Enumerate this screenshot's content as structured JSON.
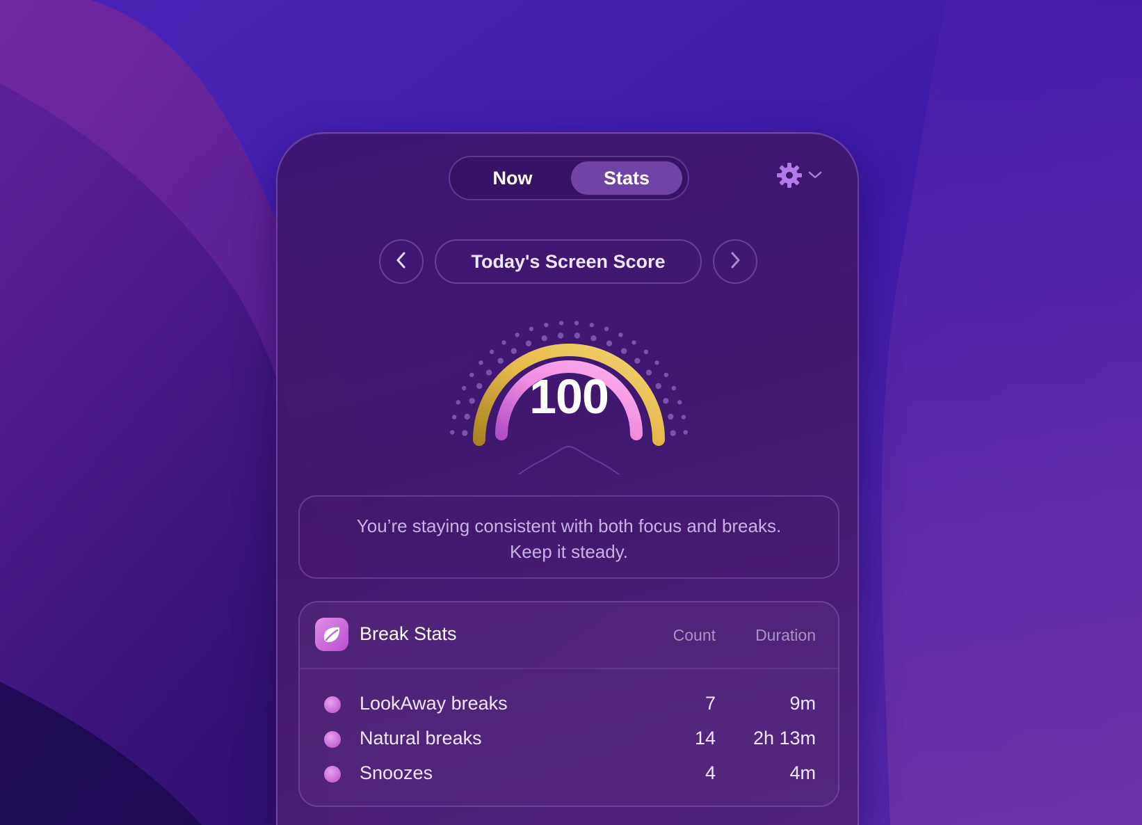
{
  "tabs": {
    "now_label": "Now",
    "stats_label": "Stats",
    "active": "Stats"
  },
  "settings": {
    "icon": "gear-icon",
    "chevron": "chevron-down-icon"
  },
  "score_nav": {
    "title": "Today's Screen Score",
    "prev_icon": "chevron-left-icon",
    "next_icon": "chevron-right-icon"
  },
  "gauge": {
    "value": "100",
    "outer_color": "#e6b94a",
    "inner_color": "#f08ee0"
  },
  "message": {
    "text": "You’re staying consistent with both focus and breaks. Keep it steady."
  },
  "break_stats": {
    "title": "Break Stats",
    "icon": "leaf-icon",
    "columns": {
      "count": "Count",
      "duration": "Duration"
    },
    "rows": [
      {
        "label": "LookAway breaks",
        "count": "7",
        "duration": "9m"
      },
      {
        "label": "Natural breaks",
        "count": "14",
        "duration": "2h 13m"
      },
      {
        "label": "Snoozes",
        "count": "4",
        "duration": "4m"
      }
    ]
  },
  "colors": {
    "accent": "#a06edc",
    "dot": "#c866d8"
  }
}
